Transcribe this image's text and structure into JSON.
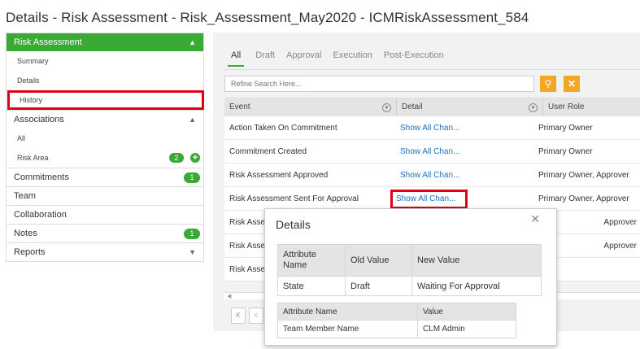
{
  "page_title": "Details - Risk Assessment - Risk_Assessment_May2020 - ICMRiskAssessment_584",
  "sidebar": {
    "risk_assessment": {
      "label": "Risk Assessment",
      "items": [
        "Summary",
        "Details",
        "History"
      ]
    },
    "associations": {
      "label": "Associations",
      "items": [
        {
          "label": "All"
        },
        {
          "label": "Risk Area",
          "badge": "2"
        }
      ]
    },
    "sections": [
      {
        "label": "Commitments",
        "badge": "1"
      },
      {
        "label": "Team"
      },
      {
        "label": "Collaboration"
      },
      {
        "label": "Notes",
        "badge": "1"
      },
      {
        "label": "Reports"
      }
    ]
  },
  "tabs": [
    "All",
    "Draft",
    "Approval",
    "Execution",
    "Post-Execution"
  ],
  "search": {
    "placeholder": "Refine Search Here..."
  },
  "grid": {
    "headers": [
      "Event",
      "Detail",
      "User Role"
    ],
    "rows": [
      {
        "event": "Action Taken On Commitment",
        "detail": "Show All Chan...",
        "role": "Primary Owner"
      },
      {
        "event": "Commitment Created",
        "detail": "Show All Chan...",
        "role": "Primary Owner"
      },
      {
        "event": "Risk Assessment Approved",
        "detail": "Show All Chan...",
        "role": "Primary Owner, Approver"
      },
      {
        "event": "Risk Assessment Sent For Approval",
        "detail": "Show All Chan...",
        "role": "Primary Owner, Approver"
      },
      {
        "event": "Risk Asse",
        "detail": "",
        "role": "Approver"
      },
      {
        "event": "Risk Asse",
        "detail": "",
        "role": "Approver"
      },
      {
        "event": "Risk Asse",
        "detail": "",
        "role": ""
      }
    ]
  },
  "pager": [
    "K",
    "<"
  ],
  "dialog": {
    "title": "Details",
    "changes": {
      "headers": [
        "Attribute Name",
        "Old Value",
        "New Value"
      ],
      "row": [
        "State",
        "Draft",
        "Waiting For Approval"
      ]
    },
    "team": {
      "headers": [
        "Attribute Name",
        "Value"
      ],
      "row": [
        "Team Member Name",
        "CLM Admin"
      ]
    }
  },
  "colors": {
    "accent": "#3aa935",
    "highlight": "#e00016",
    "search_button": "#f5a623",
    "link": "#1a73c7"
  }
}
